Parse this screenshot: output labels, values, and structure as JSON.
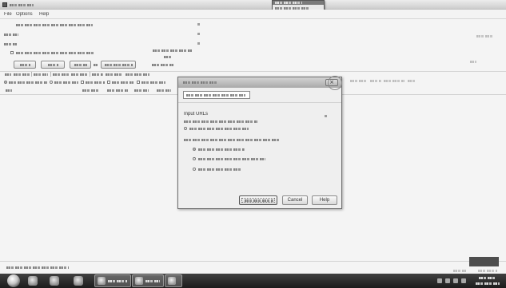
{
  "window": {
    "icon": "app-window-icon"
  },
  "menu": {
    "items": [
      "File",
      "Options",
      "Help"
    ]
  },
  "dialog": {
    "section_heading": "Input URLs",
    "buttons": {
      "cancel": "Cancel",
      "help": "Help"
    },
    "close_icon": "close-icon"
  },
  "icons": {
    "start_button": "windows-start-icon",
    "pinned": [
      "pinned-app-icon",
      "pinned-app-icon",
      "pinned-app-icon"
    ],
    "tray": "system-tray-icons",
    "cursor_marker": "cursor-highlight-ring"
  },
  "colors": {
    "background": "#f4f4f4",
    "window_title_bar": "#cdcdcd",
    "dialog_title_bar": "#a9a9a9",
    "taskbar": "#262626",
    "status_indicator": "#4d4d4d"
  }
}
